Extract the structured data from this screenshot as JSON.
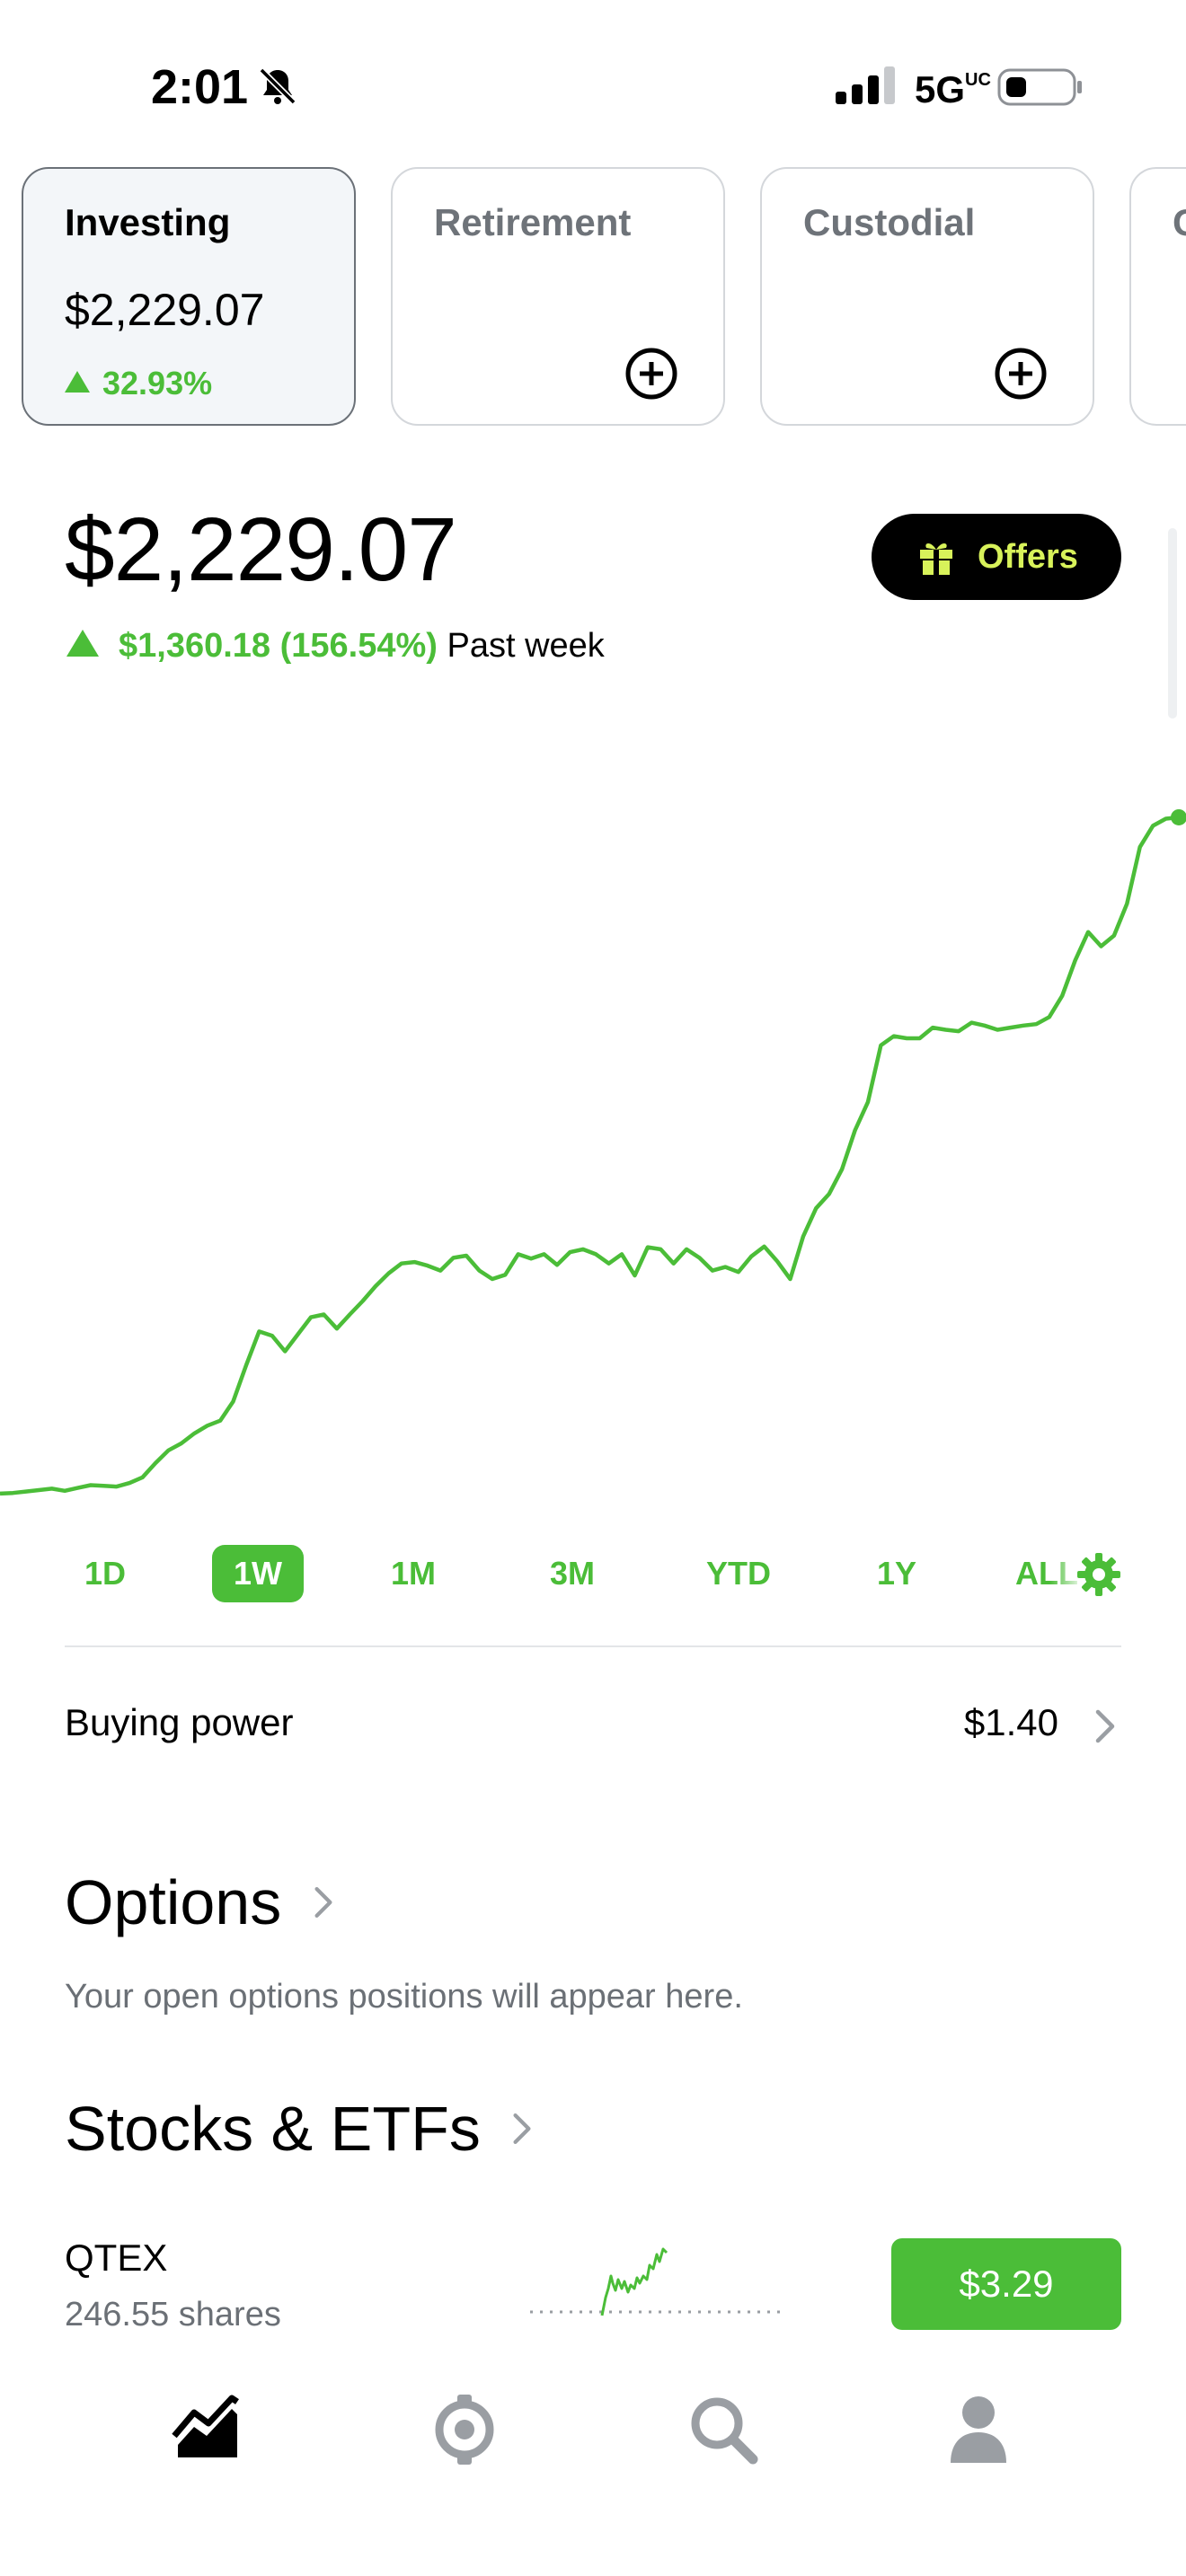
{
  "status_bar": {
    "time": "2:01",
    "network": "5G",
    "network_sup": "UC",
    "icons": [
      "bell-slash-icon",
      "signal-bars-icon",
      "battery-icon"
    ]
  },
  "accounts": [
    {
      "title": "Investing",
      "value": "$2,229.07",
      "change": "32.93%",
      "selected": true
    },
    {
      "title": "Retirement",
      "icon": "plus-circle-icon"
    },
    {
      "title": "Custodial",
      "icon": "plus-circle-icon"
    },
    {
      "title": "C"
    }
  ],
  "portfolio": {
    "value": "$2,229.07",
    "change_amount": "$1,360.18 (156.54%)",
    "change_period": "Past week",
    "offers_label": "Offers",
    "offers_icon": "gift-icon"
  },
  "chart_data": {
    "type": "line",
    "color": "#4bbd38",
    "points": [
      [
        0,
        47
      ],
      [
        1,
        48
      ],
      [
        2,
        50
      ],
      [
        3,
        52
      ],
      [
        4,
        54
      ],
      [
        5,
        51
      ],
      [
        6,
        55
      ],
      [
        7,
        59
      ],
      [
        8,
        58
      ],
      [
        9,
        57
      ],
      [
        10,
        62
      ],
      [
        11,
        70
      ],
      [
        12,
        90
      ],
      [
        13,
        108
      ],
      [
        14,
        118
      ],
      [
        15,
        132
      ],
      [
        16,
        143
      ],
      [
        17,
        150
      ],
      [
        18,
        177
      ],
      [
        19,
        228
      ],
      [
        20,
        276
      ],
      [
        21,
        270
      ],
      [
        22,
        248
      ],
      [
        23,
        272
      ],
      [
        24,
        296
      ],
      [
        25,
        300
      ],
      [
        26,
        280
      ],
      [
        27,
        300
      ],
      [
        28,
        319
      ],
      [
        29,
        340
      ],
      [
        30,
        358
      ],
      [
        31,
        372
      ],
      [
        32,
        374
      ],
      [
        33,
        369
      ],
      [
        34,
        362
      ],
      [
        35,
        380
      ],
      [
        36,
        383
      ],
      [
        37,
        362
      ],
      [
        38,
        350
      ],
      [
        39,
        356
      ],
      [
        40,
        385
      ],
      [
        41,
        379
      ],
      [
        42,
        385
      ],
      [
        43,
        370
      ],
      [
        44,
        388
      ],
      [
        45,
        392
      ],
      [
        46,
        385
      ],
      [
        47,
        372
      ],
      [
        48,
        385
      ],
      [
        49,
        355
      ],
      [
        50,
        395
      ],
      [
        51,
        392
      ],
      [
        52,
        372
      ],
      [
        53,
        392
      ],
      [
        54,
        380
      ],
      [
        55,
        362
      ],
      [
        56,
        367
      ],
      [
        57,
        360
      ],
      [
        58,
        382
      ],
      [
        59,
        396
      ],
      [
        60,
        375
      ],
      [
        61,
        350
      ],
      [
        62,
        410
      ],
      [
        63,
        450
      ],
      [
        64,
        470
      ],
      [
        65,
        505
      ],
      [
        66,
        560
      ],
      [
        67,
        600
      ],
      [
        68,
        680
      ],
      [
        69,
        693
      ],
      [
        70,
        690
      ],
      [
        71,
        690
      ],
      [
        72,
        705
      ],
      [
        73,
        702
      ],
      [
        74,
        700
      ],
      [
        75,
        712
      ],
      [
        76,
        708
      ],
      [
        77,
        702
      ],
      [
        78,
        705
      ],
      [
        79,
        708
      ],
      [
        80,
        710
      ],
      [
        81,
        720
      ],
      [
        82,
        750
      ],
      [
        83,
        800
      ],
      [
        84,
        840
      ],
      [
        85,
        820
      ],
      [
        86,
        835
      ],
      [
        87,
        880
      ],
      [
        88,
        960
      ],
      [
        89,
        990
      ],
      [
        90,
        1000
      ],
      [
        91,
        1002
      ]
    ],
    "xlim": [
      0,
      91
    ],
    "ylim": [
      0,
      1040
    ]
  },
  "time_ranges": [
    {
      "label": "1D",
      "active": false
    },
    {
      "label": "1W",
      "active": true
    },
    {
      "label": "1M",
      "active": false
    },
    {
      "label": "3M",
      "active": false
    },
    {
      "label": "YTD",
      "active": false
    },
    {
      "label": "1Y",
      "active": false
    },
    {
      "label": "ALL",
      "active": false
    }
  ],
  "buying_power": {
    "label": "Buying power",
    "value": "$1.40"
  },
  "options": {
    "title": "Options",
    "subtitle": "Your open options positions will appear here."
  },
  "stocks": {
    "title": "Stocks & ETFs",
    "items": [
      {
        "symbol": "QTEX",
        "shares": "246.55 shares",
        "price": "$3.29"
      }
    ]
  },
  "bottom_nav": [
    {
      "name": "investing-tab",
      "icon": "chart-trend-icon"
    },
    {
      "name": "crypto-tab",
      "icon": "crypto-coin-icon"
    },
    {
      "name": "search-tab",
      "icon": "search-icon"
    },
    {
      "name": "account-tab",
      "icon": "person-icon"
    }
  ]
}
